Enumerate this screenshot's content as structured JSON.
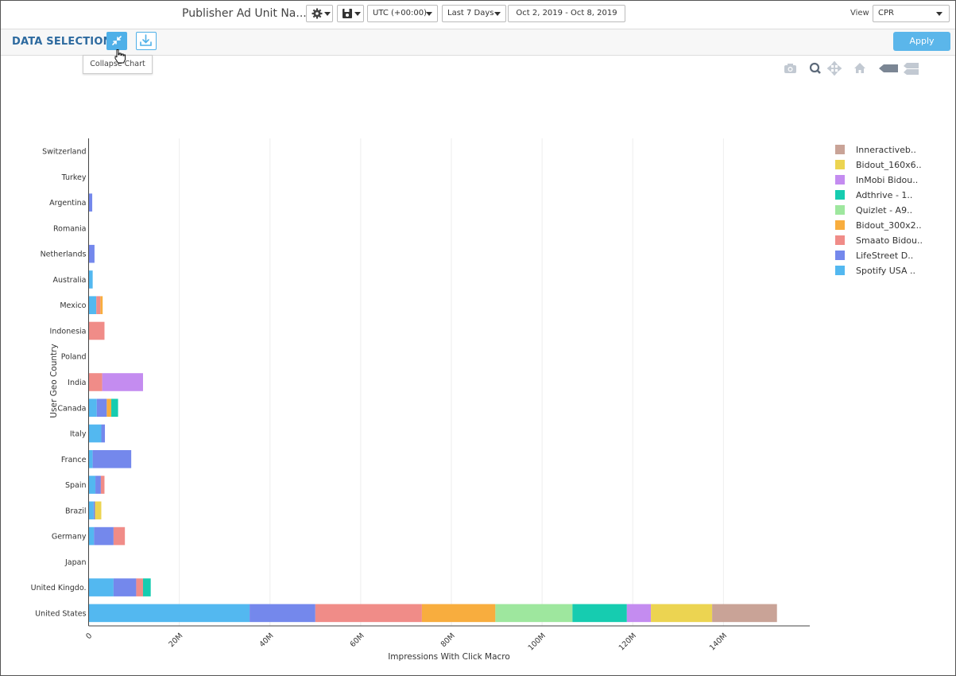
{
  "header": {
    "report_title": "Publisher Ad Unit Na...",
    "timezone": "UTC (+00:00)",
    "date_preset": "Last 7 Days",
    "date_range": "Oct 2, 2019 - Oct 8, 2019",
    "view_label": "View",
    "view_value": "CPR",
    "icons": [
      "gear-icon",
      "save-icon"
    ]
  },
  "selection_bar": {
    "title": "DATA SELECTION",
    "apply_label": "Apply",
    "collapse_tooltip": "Collapse Chart",
    "icons": [
      "collapse-icon",
      "download-icon"
    ]
  },
  "modebar_icons": [
    "camera-icon",
    "zoom-icon",
    "pan-icon",
    "home-icon",
    "hover-closest-icon",
    "hover-compare-icon"
  ],
  "colors": {
    "accent": "#5bb6ea",
    "title_blue": "#2d6a9f"
  },
  "chart_data": {
    "type": "bar",
    "orientation": "horizontal",
    "stacked": true,
    "xlabel": "Impressions With Click Macro",
    "ylabel": "User Geo Country",
    "xlim": [
      0,
      160000000
    ],
    "xticks": [
      0,
      20000000,
      40000000,
      60000000,
      80000000,
      100000000,
      120000000,
      140000000
    ],
    "xtick_labels": [
      "0",
      "20M",
      "40M",
      "60M",
      "80M",
      "100M",
      "120M",
      "140M"
    ],
    "grid": true,
    "legend_position": "right",
    "categories": [
      "United States",
      "United Kingdo.",
      "Japan",
      "Germany",
      "Brazil",
      "Spain",
      "France",
      "Italy",
      "Canada",
      "India",
      "Poland",
      "Indonesia",
      "Mexico",
      "Australia",
      "Netherlands",
      "Romania",
      "Argentina",
      "Turkey",
      "Switzerland"
    ],
    "series": [
      {
        "name": "Spotify USA ..",
        "color": "#53b8f0",
        "values": [
          35500000,
          5500000,
          0,
          1200000,
          1100000,
          1500000,
          900000,
          2800000,
          1800000,
          0,
          0,
          0,
          1700000,
          900000,
          0,
          0,
          0,
          0,
          0
        ]
      },
      {
        "name": "LifeStreet D..",
        "color": "#7488ec",
        "values": [
          14500000,
          5000000,
          0,
          4300000,
          300000,
          1200000,
          8500000,
          800000,
          2200000,
          0,
          0,
          0,
          0,
          0,
          1300000,
          0,
          800000,
          0,
          0
        ]
      },
      {
        "name": "Smaato Bidou..",
        "color": "#f08c88",
        "values": [
          23500000,
          1500000,
          0,
          2500000,
          0,
          800000,
          0,
          0,
          0,
          3000000,
          0,
          3500000,
          900000,
          0,
          0,
          0,
          0,
          0,
          0
        ]
      },
      {
        "name": "Bidout_300x2..",
        "color": "#f8ad3e",
        "values": [
          16200000,
          0,
          0,
          0,
          0,
          0,
          0,
          0,
          1000000,
          0,
          0,
          0,
          500000,
          0,
          0,
          0,
          0,
          0,
          0
        ]
      },
      {
        "name": "Quizlet - A9..",
        "color": "#9ee79e",
        "values": [
          17000000,
          0,
          0,
          0,
          0,
          0,
          0,
          0,
          0,
          0,
          0,
          0,
          0,
          0,
          0,
          0,
          0,
          0,
          0
        ]
      },
      {
        "name": "Adthrive - 1..",
        "color": "#16ccb0",
        "values": [
          12000000,
          1700000,
          0,
          0,
          0,
          0,
          0,
          0,
          1500000,
          0,
          0,
          0,
          0,
          0,
          0,
          0,
          0,
          0,
          0
        ]
      },
      {
        "name": "InMobi Bidou..",
        "color": "#c48cf0",
        "values": [
          5300000,
          0,
          0,
          0,
          0,
          0,
          0,
          0,
          0,
          9000000,
          0,
          0,
          0,
          0,
          0,
          0,
          0,
          0,
          0
        ]
      },
      {
        "name": "Bidout_160x6..",
        "color": "#ecd451",
        "values": [
          13500000,
          0,
          0,
          0,
          1400000,
          0,
          0,
          0,
          0,
          0,
          0,
          0,
          0,
          0,
          0,
          0,
          0,
          0,
          0
        ]
      },
      {
        "name": "Inneractiveb..",
        "color": "#c9a397",
        "values": [
          14300000,
          0,
          0,
          0,
          0,
          0,
          0,
          0,
          0,
          0,
          0,
          0,
          0,
          0,
          0,
          0,
          0,
          0,
          0
        ]
      }
    ],
    "legend_order": [
      "Inneractiveb..",
      "Bidout_160x6..",
      "InMobi Bidou..",
      "Adthrive - 1..",
      "Quizlet - A9..",
      "Bidout_300x2..",
      "Smaato Bidou..",
      "LifeStreet D..",
      "Spotify USA .."
    ]
  }
}
